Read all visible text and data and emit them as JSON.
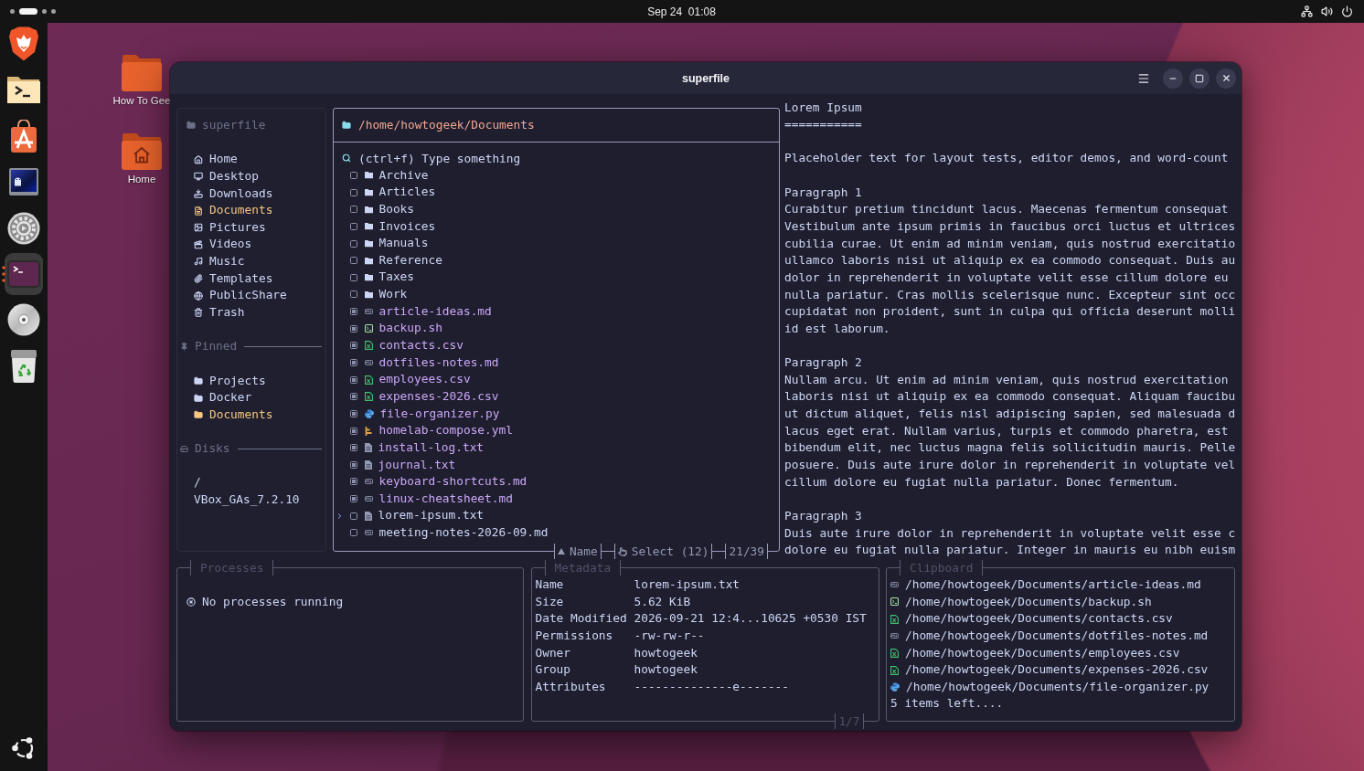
{
  "top_bar": {
    "workspaces": [
      {
        "selected": false
      },
      {
        "selected": true
      },
      {
        "selected": false
      },
      {
        "selected": false
      }
    ],
    "clock": "Sep 24  01:08"
  },
  "dock": {
    "apps": [
      {
        "kind": "browser",
        "running": false,
        "focused": false
      },
      {
        "kind": "files",
        "running": false,
        "focused": false
      },
      {
        "kind": "app-center",
        "running": false,
        "focused": false
      },
      {
        "kind": "remote-viewer",
        "running": false,
        "focused": false
      },
      {
        "kind": "settings",
        "running": false,
        "focused": false
      },
      {
        "kind": "terminal",
        "running": true,
        "focused": true
      },
      {
        "kind": "disc",
        "running": false,
        "focused": false
      },
      {
        "kind": "trash",
        "running": false,
        "focused": false
      }
    ]
  },
  "desktop": {
    "icons": [
      {
        "label": "How To Gee",
        "kind": "folder"
      },
      {
        "label": "Home",
        "kind": "home"
      }
    ]
  },
  "window": {
    "title": "superfile"
  },
  "sidebar": {
    "title": "superfile",
    "well_known": [
      {
        "label": "Home",
        "selected": false
      },
      {
        "label": "Desktop",
        "selected": false
      },
      {
        "label": "Downloads",
        "selected": false
      },
      {
        "label": "Documents",
        "selected": true
      },
      {
        "label": "Pictures",
        "selected": false
      },
      {
        "label": "Videos",
        "selected": false
      },
      {
        "label": "Music",
        "selected": false
      },
      {
        "label": "Templates",
        "selected": false
      },
      {
        "label": "PublicShare",
        "selected": false
      },
      {
        "label": "Trash",
        "selected": false
      }
    ],
    "pinned": {
      "title": "Pinned",
      "items": [
        {
          "label": "Projects",
          "selected": false
        },
        {
          "label": "Docker",
          "selected": false
        },
        {
          "label": "Documents",
          "selected": true
        }
      ]
    },
    "disks": {
      "title": "Disks",
      "items": [
        {
          "label": "/"
        },
        {
          "label": "VBox_GAs_7.2.10"
        }
      ]
    }
  },
  "file_panel": {
    "path": "/home/howtogeek/Documents",
    "search": {
      "placeholder": "(ctrl+f) Type something"
    },
    "items": [
      {
        "name": "Archive",
        "kind": "folder",
        "checked": false,
        "selected": false
      },
      {
        "name": "Articles",
        "kind": "folder",
        "checked": false,
        "selected": false
      },
      {
        "name": "Books",
        "kind": "folder",
        "checked": false,
        "selected": false
      },
      {
        "name": "Invoices",
        "kind": "folder",
        "checked": false,
        "selected": false
      },
      {
        "name": "Manuals",
        "kind": "folder",
        "checked": false,
        "selected": false
      },
      {
        "name": "Reference",
        "kind": "folder",
        "checked": false,
        "selected": false
      },
      {
        "name": "Taxes",
        "kind": "folder",
        "checked": false,
        "selected": false
      },
      {
        "name": "Work",
        "kind": "folder",
        "checked": false,
        "selected": false
      },
      {
        "name": "article-ideas.md",
        "kind": "markdown",
        "checked": true,
        "selected": false
      },
      {
        "name": "backup.sh",
        "kind": "shell",
        "checked": true,
        "selected": false
      },
      {
        "name": "contacts.csv",
        "kind": "csv",
        "checked": true,
        "selected": false
      },
      {
        "name": "dotfiles-notes.md",
        "kind": "markdown",
        "checked": true,
        "selected": false
      },
      {
        "name": "employees.csv",
        "kind": "csv",
        "checked": true,
        "selected": false
      },
      {
        "name": "expenses-2026.csv",
        "kind": "csv",
        "checked": true,
        "selected": false
      },
      {
        "name": "file-organizer.py",
        "kind": "python",
        "checked": true,
        "selected": false
      },
      {
        "name": "homelab-compose.yml",
        "kind": "yaml",
        "checked": true,
        "selected": false
      },
      {
        "name": "install-log.txt",
        "kind": "text",
        "checked": true,
        "selected": false
      },
      {
        "name": "journal.txt",
        "kind": "text",
        "checked": true,
        "selected": false
      },
      {
        "name": "keyboard-shortcuts.md",
        "kind": "markdown",
        "checked": true,
        "selected": false
      },
      {
        "name": "linux-cheatsheet.md",
        "kind": "markdown",
        "checked": true,
        "selected": false
      },
      {
        "name": "lorem-ipsum.txt",
        "kind": "text",
        "checked": false,
        "selected": true
      },
      {
        "name": "meeting-notes-2026-09.md",
        "kind": "markdown",
        "checked": false,
        "selected": false
      }
    ],
    "footer": {
      "sort": "Name",
      "selection": "Select (12)",
      "position": "21/39"
    }
  },
  "preview": {
    "blocks": [
      {
        "lines": [
          "Lorem Ipsum",
          "==========="
        ]
      },
      {
        "lines": [
          "Placeholder text for layout tests, editor demos, and word-count"
        ]
      },
      {
        "lines": [
          "Paragraph 1",
          "Curabitur pretium tincidunt lacus. Maecenas fermentum consequat",
          "Vestibulum ante ipsum primis in faucibus orci luctus et ultrices",
          "cubilia curae. Ut enim ad minim veniam, quis nostrud exercitatio",
          "ullamco laboris nisi ut aliquip ex ea commodo consequat. Duis au",
          "dolor in reprehenderit in voluptate velit esse cillum dolore eu",
          "nulla pariatur. Cras mollis scelerisque nunc. Excepteur sint occ",
          "cupidatat non proident, sunt in culpa qui officia deserunt molli",
          "id est laborum."
        ]
      },
      {
        "lines": [
          "Paragraph 2",
          "Nullam arcu. Ut enim ad minim veniam, quis nostrud exercitation",
          "laboris nisi ut aliquip ex ea commodo consequat. Aliquam faucibu",
          "ut dictum aliquet, felis nisl adipiscing sapien, sed malesuada d",
          "lacus eget erat. Nullam varius, turpis et commodo pharetra, est",
          "bibendum elit, nec luctus magna felis sollicitudin mauris. Pelle",
          "posuere. Duis aute irure dolor in reprehenderit in voluptate vel",
          "cillum dolore eu fugiat nulla pariatur. Donec fermentum."
        ]
      },
      {
        "lines": [
          "Paragraph 3",
          "Duis aute irure dolor in reprehenderit in voluptate velit esse c",
          "dolore eu fugiat nulla pariatur. Integer in mauris eu nibh euism"
        ]
      }
    ]
  },
  "processes": {
    "title": "Processes",
    "message": "No processes running"
  },
  "metadata": {
    "title": "Metadata",
    "rows": [
      {
        "label": "Name",
        "value": "lorem-ipsum.txt"
      },
      {
        "label": "Size",
        "value": "5.62 KiB"
      },
      {
        "label": "Date Modified",
        "value": "2026-09-21 12:4...10625 +0530 IST"
      },
      {
        "label": "Permissions",
        "value": "-rw-rw-r--"
      },
      {
        "label": "Owner",
        "value": "howtogeek"
      },
      {
        "label": "Group",
        "value": "howtogeek"
      },
      {
        "label": "Attributes",
        "value": "--------------e-------"
      }
    ],
    "page": "1/7"
  },
  "clipboard": {
    "title": "Clipboard",
    "items": [
      {
        "path": "/home/howtogeek/Documents/article-ideas.md",
        "kind": "markdown"
      },
      {
        "path": "/home/howtogeek/Documents/backup.sh",
        "kind": "shell"
      },
      {
        "path": "/home/howtogeek/Documents/contacts.csv",
        "kind": "csv"
      },
      {
        "path": "/home/howtogeek/Documents/dotfiles-notes.md",
        "kind": "markdown"
      },
      {
        "path": "/home/howtogeek/Documents/employees.csv",
        "kind": "csv"
      },
      {
        "path": "/home/howtogeek/Documents/expenses-2026.csv",
        "kind": "csv"
      },
      {
        "path": "/home/howtogeek/Documents/file-organizer.py",
        "kind": "python"
      }
    ],
    "more": "5 items left...."
  }
}
